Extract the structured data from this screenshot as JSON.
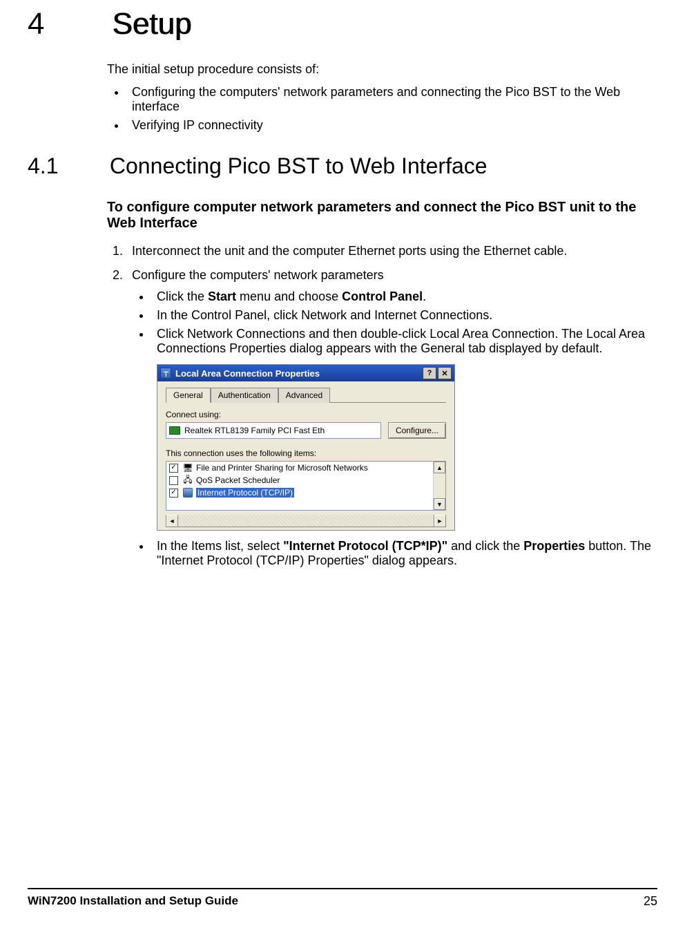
{
  "chapter": {
    "number": "4",
    "title": "Setup"
  },
  "intro": "The initial setup procedure consists of:",
  "top_bullets": [
    "Configuring the computers' network parameters and connecting the Pico BST to the Web interface",
    "Verifying IP connectivity"
  ],
  "section": {
    "number": "4.1",
    "title": "Connecting Pico BST to Web Interface"
  },
  "procedure_title": "To configure computer network parameters and connect the Pico BST unit to the Web Interface",
  "steps": {
    "s1": "Interconnect the unit and the computer Ethernet ports using the Ethernet cable.",
    "s2": "Configure the computers' network parameters",
    "s2_bullets": {
      "b1_pre": "Click the ",
      "b1_bold1": "Start",
      "b1_mid": " menu and choose ",
      "b1_bold2": "Control Panel",
      "b1_post": ".",
      "b2": "In the Control Panel, click Network and Internet Connections.",
      "b3": "Click Network Connections and then double-click Local Area Connection. The Local Area Connections Properties dialog appears with the General tab displayed by default.",
      "b4_pre": "In the Items list, select ",
      "b4_bold1": "\"Internet Protocol (TCP*IP)\"",
      "b4_mid": " and click the ",
      "b4_bold2": "Properties",
      "b4_post": " button. The \"Internet Protocol (TCP/IP) Properties\" dialog appears."
    }
  },
  "dialog": {
    "title": "Local Area Connection Properties",
    "help_btn": "?",
    "close_btn": "✕",
    "tabs": {
      "general": "General",
      "auth": "Authentication",
      "advanced": "Advanced"
    },
    "connect_using_label": "Connect using:",
    "adapter_name": "Realtek RTL8139 Family PCI Fast Eth",
    "configure_btn": "Configure...",
    "items_label": "This connection uses the following items:",
    "items": {
      "i1": {
        "checked": "✓",
        "label": "File and Printer Sharing for Microsoft Networks"
      },
      "i2": {
        "checked": "",
        "label": "QoS Packet Scheduler"
      },
      "i3": {
        "checked": "✓",
        "label": "Internet Protocol (TCP/IP)"
      }
    },
    "scroll": {
      "up": "▲",
      "down": "▼",
      "left": "◄",
      "right": "►"
    }
  },
  "footer": {
    "title": "WiN7200 Installation and Setup Guide",
    "page": "25"
  }
}
